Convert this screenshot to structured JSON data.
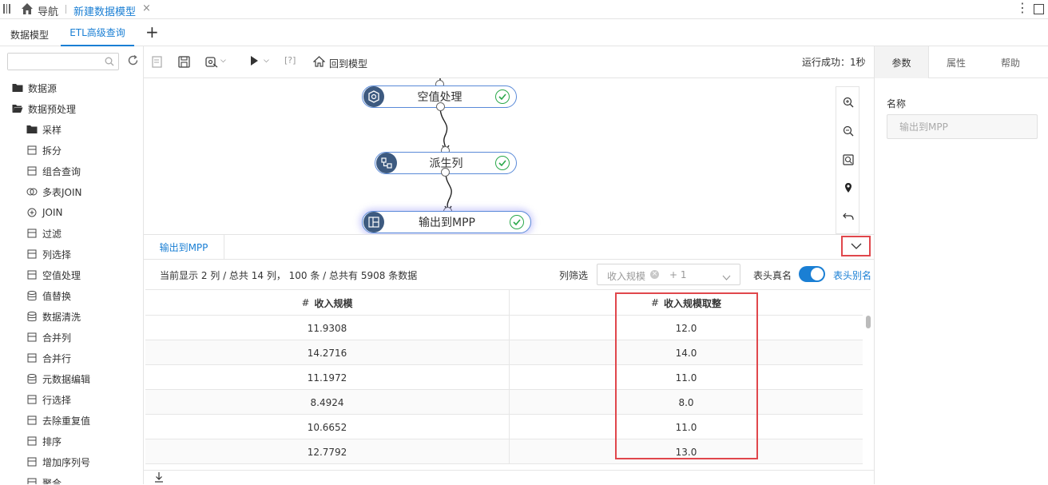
{
  "titlebar": {
    "menu_icon": "menu-icon",
    "home_icon": "home-icon",
    "nav_label": "导航",
    "active_tab": "新建数据模型",
    "close_icon": "close-icon"
  },
  "tabs": [
    {
      "label": "数据模型"
    },
    {
      "label": "ETL高级查询"
    }
  ],
  "sidebar": {
    "search_placeholder": "",
    "items": [
      {
        "label": "数据源",
        "icon": "folder-icon",
        "level": 0
      },
      {
        "label": "数据预处理",
        "icon": "folder-open-icon",
        "level": 0
      },
      {
        "label": "采样",
        "icon": "folder-icon",
        "level": 1
      },
      {
        "label": "拆分",
        "icon": "split-icon",
        "level": 1
      },
      {
        "label": "组合查询",
        "icon": "combine-icon",
        "level": 1
      },
      {
        "label": "多表JOIN",
        "icon": "join-icon",
        "level": 1
      },
      {
        "label": "JOIN",
        "icon": "plus-circle-icon",
        "level": 1
      },
      {
        "label": "过滤",
        "icon": "filter-icon",
        "level": 1
      },
      {
        "label": "列选择",
        "icon": "column-select-icon",
        "level": 1
      },
      {
        "label": "空值处理",
        "icon": "null-icon",
        "level": 1
      },
      {
        "label": "值替换",
        "icon": "database-icon",
        "level": 1
      },
      {
        "label": "数据清洗",
        "icon": "database-icon",
        "level": 1
      },
      {
        "label": "合并列",
        "icon": "merge-column-icon",
        "level": 1
      },
      {
        "label": "合并行",
        "icon": "merge-row-icon",
        "level": 1
      },
      {
        "label": "元数据编辑",
        "icon": "database-icon",
        "level": 1
      },
      {
        "label": "行选择",
        "icon": "row-select-icon",
        "level": 1
      },
      {
        "label": "去除重复值",
        "icon": "dedupe-icon",
        "level": 1
      },
      {
        "label": "排序",
        "icon": "sort-icon",
        "level": 1
      },
      {
        "label": "增加序列号",
        "icon": "sequence-icon",
        "level": 1
      },
      {
        "label": "聚合",
        "icon": "aggregate-icon",
        "level": 1
      }
    ]
  },
  "toolbar": {
    "help_label": "[?]",
    "back_label": "回到模型",
    "status": "运行成功：1秒"
  },
  "flow": {
    "nodes": [
      {
        "label": "空值处理",
        "icon": "null-icon"
      },
      {
        "label": "派生列",
        "icon": "derive-icon"
      },
      {
        "label": "输出到MPP",
        "icon": "output-icon"
      }
    ]
  },
  "bottom": {
    "tab_label": "输出到MPP",
    "summary": "当前显示 2 列 / 总共 14 列， 100 条 / 总共有 5908 条数据",
    "filter_label": "列筛选",
    "filter_tag": "收入规模",
    "filter_more": "+ 1",
    "realname_label": "表头真名",
    "alias_label": "表头别名",
    "columns": [
      {
        "prefix": "#",
        "label": "收入规模"
      },
      {
        "prefix": "#",
        "label": "收入规模取整"
      }
    ],
    "rows": [
      [
        "11.9308",
        "12.0"
      ],
      [
        "14.2716",
        "14.0"
      ],
      [
        "11.1972",
        "11.0"
      ],
      [
        "8.4924",
        "8.0"
      ],
      [
        "10.6652",
        "11.0"
      ],
      [
        "12.7792",
        "13.0"
      ]
    ]
  },
  "right": {
    "tabs": [
      {
        "label": "参数"
      },
      {
        "label": "属性"
      },
      {
        "label": "帮助"
      }
    ],
    "name_label": "名称",
    "name_value": "输出到MPP"
  },
  "colors": {
    "accent": "#1a7fd4",
    "node_border": "#5a8ad8",
    "success": "#2aa84a",
    "highlight": "#e0474c"
  }
}
